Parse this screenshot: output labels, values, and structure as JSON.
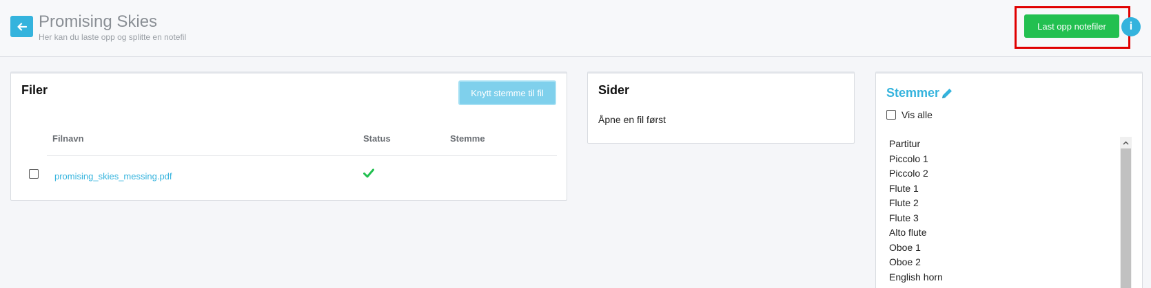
{
  "header": {
    "title": "Promising Skies",
    "subtitle": "Her kan du laste opp og splitte en notefil",
    "upload_button": "Last opp notefiler",
    "info_button": "i"
  },
  "files": {
    "title": "Filer",
    "link_button": "Knytt stemme til fil",
    "columns": {
      "filename": "Filnavn",
      "status": "Status",
      "voice": "Stemme"
    },
    "rows": [
      {
        "filename": "promising_skies_messing.pdf",
        "status_icon": "check-icon",
        "voice": ""
      }
    ]
  },
  "pages": {
    "title": "Sider",
    "empty_text": "Åpne en fil først"
  },
  "voices": {
    "title": "Stemmer",
    "show_all_label": "Vis alle",
    "items": [
      "Partitur",
      "Piccolo 1",
      "Piccolo 2",
      "Flute 1",
      "Flute 2",
      "Flute 3",
      "Alto flute",
      "Oboe 1",
      "Oboe 2",
      "English horn"
    ]
  },
  "colors": {
    "accent": "#34b3dd",
    "upload_green": "#22c050",
    "highlight_red": "#e00000",
    "check_green": "#22c050"
  }
}
